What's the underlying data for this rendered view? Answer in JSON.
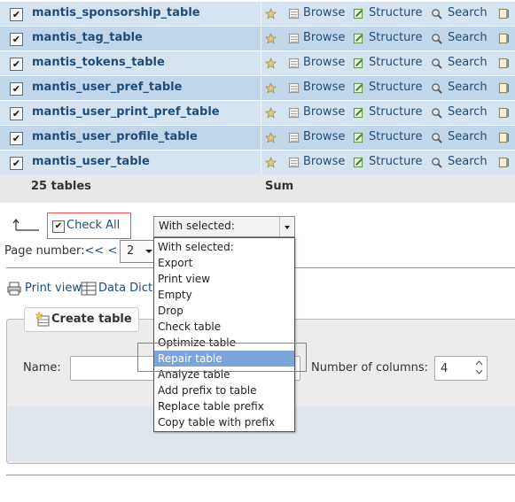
{
  "table_rows": [
    {
      "name": "mantis_sponsorship_table",
      "checked": true
    },
    {
      "name": "mantis_tag_table",
      "checked": true
    },
    {
      "name": "mantis_tokens_table",
      "checked": true
    },
    {
      "name": "mantis_user_pref_table",
      "checked": true
    },
    {
      "name": "mantis_user_print_pref_table",
      "checked": true
    },
    {
      "name": "mantis_user_profile_table",
      "checked": true
    },
    {
      "name": "mantis_user_table",
      "checked": true
    }
  ],
  "actions": {
    "browse": "Browse",
    "structure": "Structure",
    "search": "Search"
  },
  "footer": {
    "count_label": "25 tables",
    "sum_label": "Sum"
  },
  "check_all": {
    "label": "Check All",
    "checked": true
  },
  "with_selected": {
    "value": "With selected:",
    "options": [
      "With selected:",
      "Export",
      "Print view",
      "Empty",
      "Drop",
      "Check table",
      "Optimize table",
      "Repair table",
      "Analyze table",
      "Add prefix to table",
      "Replace table prefix",
      "Copy table with prefix"
    ],
    "highlighted": "Repair table"
  },
  "pagination": {
    "label": "Page number:",
    "first": "<<",
    "prev": "<",
    "current": "2"
  },
  "links": {
    "print_view": "Print view",
    "data_dict": "Data Dict"
  },
  "create_table": {
    "legend": "Create table",
    "name_label": "Name:",
    "name_value": "",
    "columns_label": "Number of columns:",
    "columns_value": "4"
  },
  "colors": {
    "row_odd": "#d6e3f1",
    "row_even": "#c2d6ea",
    "link": "#1f4d7a",
    "highlight": "#7ba4d8",
    "annotation": "#e05a5a"
  }
}
